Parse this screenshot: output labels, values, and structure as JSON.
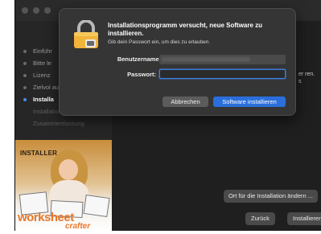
{
  "installer": {
    "steps": [
      {
        "label": "Einführ",
        "state": "done"
      },
      {
        "label": "Bitte le",
        "state": "done"
      },
      {
        "label": "Lizenz",
        "state": "done"
      },
      {
        "label": "Zielvol auswäh",
        "state": "done"
      },
      {
        "label": "Installa",
        "state": "active"
      },
      {
        "label": "Installation",
        "state": "dim"
      },
      {
        "label": "Zusammenfassung",
        "state": "dim"
      }
    ],
    "promo": {
      "installer_label": "INSTALLER",
      "brand": "worksheet",
      "brand_sub": "crafter"
    },
    "content_text": "er ren. s",
    "change_location_label": "Ort für die Installation ändern ...",
    "back_label": "Zurück",
    "install_label": "Installieren"
  },
  "auth_dialog": {
    "title": "Installationsprogramm versucht, neue Software zu installieren.",
    "description": "Gib dein Passwort ein, um dies zu erlauben.",
    "username_label": "Benutzername:",
    "password_label": "Passwort:",
    "password_value": "",
    "cancel_label": "Abbrechen",
    "confirm_label": "Software installieren"
  },
  "colors": {
    "accent": "#2a6fdb",
    "brand": "#e8772a",
    "lock_gold": "#f2b53a"
  }
}
